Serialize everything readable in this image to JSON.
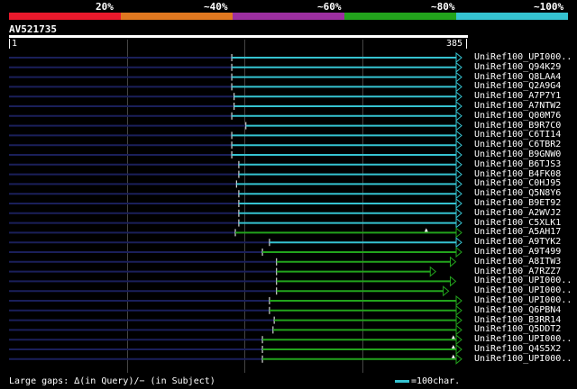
{
  "legend": {
    "bands": [
      {
        "label": "20%",
        "color": "#e8192c"
      },
      {
        "label": "~40%",
        "color": "#e07820"
      },
      {
        "label": "~60%",
        "color": "#9c2fa0"
      },
      {
        "label": "~80%",
        "color": "#22a31c"
      },
      {
        "label": "~100%",
        "color": "#35c3d1"
      }
    ]
  },
  "query": {
    "title": "AV521735",
    "start_label": "1",
    "end_label": "385",
    "length": 385
  },
  "hits": [
    {
      "name": "UniRef100_UPI000..",
      "start": 190,
      "end": 385,
      "color": "#35c3d1",
      "gap": null
    },
    {
      "name": "UniRef100_Q94K29",
      "start": 190,
      "end": 385,
      "color": "#35c3d1",
      "gap": null
    },
    {
      "name": "UniRef100_Q8LAA4",
      "start": 190,
      "end": 385,
      "color": "#35c3d1",
      "gap": null
    },
    {
      "name": "UniRef100_Q2A9G4",
      "start": 190,
      "end": 385,
      "color": "#35c3d1",
      "gap": null
    },
    {
      "name": "UniRef100_A7P7Y1",
      "start": 192,
      "end": 385,
      "color": "#35c3d1",
      "gap": null
    },
    {
      "name": "UniRef100_A7NTW2",
      "start": 192,
      "end": 385,
      "color": "#35c3d1",
      "gap": null
    },
    {
      "name": "UniRef100_Q00M76",
      "start": 190,
      "end": 385,
      "color": "#35c3d1",
      "gap": null
    },
    {
      "name": "UniRef100_B9R7C0",
      "start": 202,
      "end": 385,
      "color": "#35c3d1",
      "gap": null
    },
    {
      "name": "UniRef100_C6TI14",
      "start": 190,
      "end": 385,
      "color": "#35c3d1",
      "gap": null
    },
    {
      "name": "UniRef100_C6TBR2",
      "start": 190,
      "end": 385,
      "color": "#35c3d1",
      "gap": null
    },
    {
      "name": "UniRef100_B9GNW0",
      "start": 190,
      "end": 385,
      "color": "#35c3d1",
      "gap": null
    },
    {
      "name": "UniRef100_B6TJS3",
      "start": 196,
      "end": 385,
      "color": "#35c3d1",
      "gap": null
    },
    {
      "name": "UniRef100_B4FK08",
      "start": 196,
      "end": 385,
      "color": "#35c3d1",
      "gap": null
    },
    {
      "name": "UniRef100_C0HJ95",
      "start": 194,
      "end": 385,
      "color": "#35c3d1",
      "gap": null
    },
    {
      "name": "UniRef100_Q5N8Y6",
      "start": 196,
      "end": 385,
      "color": "#35c3d1",
      "gap": null
    },
    {
      "name": "UniRef100_B9ET92",
      "start": 196,
      "end": 385,
      "color": "#35c3d1",
      "gap": null
    },
    {
      "name": "UniRef100_A2WVJ2",
      "start": 196,
      "end": 385,
      "color": "#35c3d1",
      "gap": null
    },
    {
      "name": "UniRef100_C5XLK1",
      "start": 196,
      "end": 385,
      "color": "#35c3d1",
      "gap": null
    },
    {
      "name": "UniRef100_A5AH17",
      "start": 193,
      "end": 385,
      "color": "#22a31c",
      "gap": 355
    },
    {
      "name": "UniRef100_A9TYK2",
      "start": 222,
      "end": 385,
      "color": "#35c3d1",
      "gap": null
    },
    {
      "name": "UniRef100_A9T499",
      "start": 216,
      "end": 385,
      "color": "#22a31c",
      "gap": null
    },
    {
      "name": "UniRef100_A8ITW3",
      "start": 228,
      "end": 380,
      "color": "#22a31c",
      "gap": null
    },
    {
      "name": "UniRef100_A7RZZ7",
      "start": 228,
      "end": 363,
      "color": "#22a31c",
      "gap": null
    },
    {
      "name": "UniRef100_UPI000..",
      "start": 228,
      "end": 380,
      "color": "#22a31c",
      "gap": null
    },
    {
      "name": "UniRef100_UPI000..",
      "start": 228,
      "end": 374,
      "color": "#22a31c",
      "gap": null
    },
    {
      "name": "UniRef100_UPI000..",
      "start": 222,
      "end": 385,
      "color": "#22a31c",
      "gap": null
    },
    {
      "name": "UniRef100_Q6PBN4",
      "start": 222,
      "end": 385,
      "color": "#22a31c",
      "gap": null
    },
    {
      "name": "UniRef100_B3RR14",
      "start": 226,
      "end": 385,
      "color": "#22a31c",
      "gap": null
    },
    {
      "name": "UniRef100_Q5DDT2",
      "start": 225,
      "end": 385,
      "color": "#22a31c",
      "gap": null
    },
    {
      "name": "UniRef100_UPI000..",
      "start": 216,
      "end": 385,
      "color": "#22a31c",
      "gap": 378
    },
    {
      "name": "UniRef100_Q4S5X2",
      "start": 216,
      "end": 385,
      "color": "#22a31c",
      "gap": 378
    },
    {
      "name": "UniRef100_UPI000..",
      "start": 216,
      "end": 385,
      "color": "#22a31c",
      "gap": 378
    }
  ],
  "footer": {
    "text": "Large gaps: ∆(in Query)/− (in Subject)",
    "scale_label": "=100char."
  }
}
